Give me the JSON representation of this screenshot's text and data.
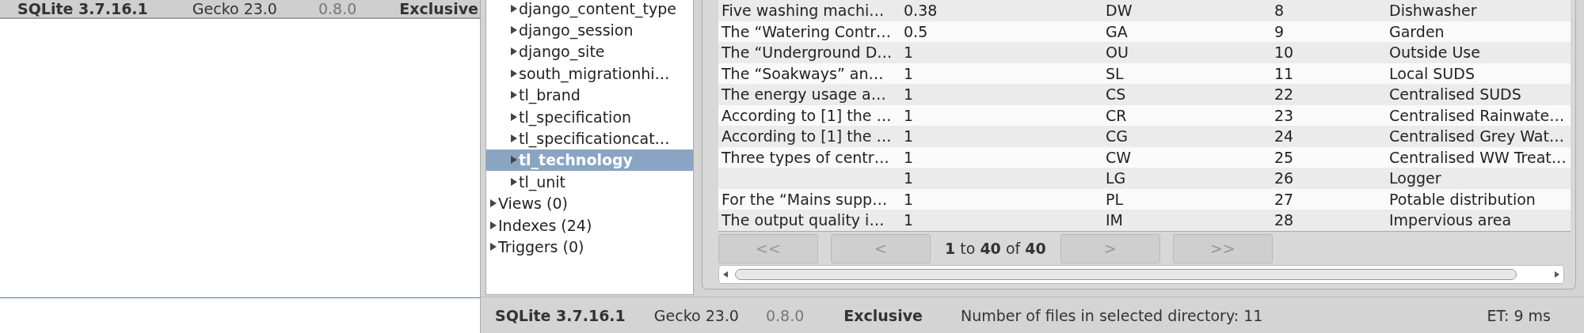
{
  "background_window": {
    "status_bar": {
      "items": [
        {
          "text": "SQLite 3.7.16.1",
          "kind": "bold"
        },
        {
          "text": "Gecko 23.0",
          "kind": "normal"
        },
        {
          "text": "0.8.0",
          "kind": "muted"
        },
        {
          "text": "Exclusive",
          "kind": "bold"
        }
      ]
    }
  },
  "sidebar": {
    "tables": [
      {
        "label": "django_content_type",
        "selected": false
      },
      {
        "label": "django_session",
        "selected": false
      },
      {
        "label": "django_site",
        "selected": false
      },
      {
        "label": "south_migrationhi…",
        "selected": false
      },
      {
        "label": "tl_brand",
        "selected": false
      },
      {
        "label": "tl_specification",
        "selected": false
      },
      {
        "label": "tl_specificationcat…",
        "selected": false
      },
      {
        "label": "tl_technology",
        "selected": true
      },
      {
        "label": "tl_unit",
        "selected": false
      }
    ],
    "sections": [
      {
        "label": "Views (0)"
      },
      {
        "label": "Indexes (24)"
      },
      {
        "label": "Triggers (0)"
      }
    ]
  },
  "table": {
    "rows": [
      {
        "column_1": "Five washing machi…",
        "column_2": "0.38",
        "column_3": "DW",
        "column_4": "8",
        "column_5": "Dishwasher"
      },
      {
        "column_1": "The “Watering Contr…",
        "column_2": "0.5",
        "column_3": "GA",
        "column_4": "9",
        "column_5": "Garden"
      },
      {
        "column_1": "The “Underground D…",
        "column_2": "1",
        "column_3": "OU",
        "column_4": "10",
        "column_5": "Outside Use"
      },
      {
        "column_1": "The “Soakways” an…",
        "column_2": "1",
        "column_3": "SL",
        "column_4": "11",
        "column_5": "Local SUDS"
      },
      {
        "column_1": "The energy usage a…",
        "column_2": "1",
        "column_3": "CS",
        "column_4": "22",
        "column_5": "Centralised SUDS"
      },
      {
        "column_1": "According to [1] the …",
        "column_2": "1",
        "column_3": "CR",
        "column_4": "23",
        "column_5": "Centralised Rainwate…"
      },
      {
        "column_1": "According to [1] the …",
        "column_2": "1",
        "column_3": "CG",
        "column_4": "24",
        "column_5": "Centralised Grey Wat…"
      },
      {
        "column_1": "Three types of centr…",
        "column_2": "1",
        "column_3": "CW",
        "column_4": "25",
        "column_5": "Centralised WW Treat…"
      },
      {
        "column_2": "1",
        "column_3": "LG",
        "column_4": "26",
        "column_5": "Logger"
      },
      {
        "column_1": "For the “Mains supp…",
        "column_2": "1",
        "column_3": "PL",
        "column_4": "27",
        "column_5": "Potable distribution"
      },
      {
        "column_1": "The output quality i…",
        "column_2": "1",
        "column_3": "IM",
        "column_4": "28",
        "column_5": "Impervious area"
      }
    ]
  },
  "pager": {
    "buttons_before": [
      {
        "label": "<<",
        "disabled": true
      },
      {
        "label": "<",
        "disabled": true
      }
    ],
    "range": "**1** to **40** of **40**",
    "buttons_after": [
      {
        "label": ">",
        "disabled": true
      },
      {
        "label": ">>",
        "disabled": true
      }
    ]
  },
  "status_bar": {
    "items": [
      {
        "text": "SQLite 3.7.16.1",
        "kind": "bold"
      },
      {
        "text": "Gecko 23.0",
        "kind": "normal"
      },
      {
        "text": "0.8.0",
        "kind": "muted"
      },
      {
        "text": "Exclusive",
        "kind": "bold"
      },
      {
        "text": "Number of files in selected directory: 11",
        "kind": "normal"
      }
    ],
    "elapsed": "ET: 9 ms"
  }
}
